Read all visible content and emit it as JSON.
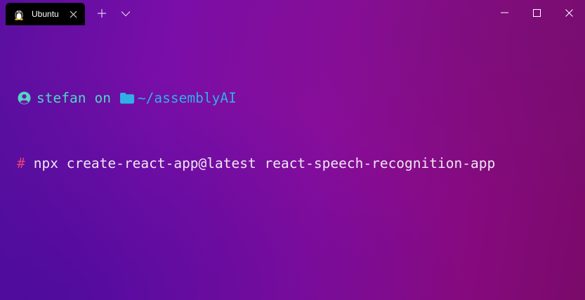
{
  "window": {
    "tab": {
      "title": "Ubuntu",
      "icon": "linux-penguin-icon"
    },
    "controls": {
      "new_tab_icon": "plus-icon",
      "dropdown_icon": "chevron-down-icon",
      "minimize_icon": "minimize-icon",
      "maximize_icon": "maximize-icon",
      "close_icon": "close-icon"
    }
  },
  "terminal": {
    "prompt": {
      "user_icon": "user-circle-icon",
      "user": "stefan",
      "connector": "on",
      "folder_icon": "folder-icon",
      "path": "~/assemblyAI"
    },
    "command": {
      "symbol": "#",
      "text": "npx create-react-app@latest react-speech-recognition-app"
    }
  },
  "colors": {
    "user": "#4fd7c3",
    "path": "#2fb1e6",
    "hash": "#e8407a",
    "command": "#f0e6f4",
    "tab_background": "#000000"
  }
}
